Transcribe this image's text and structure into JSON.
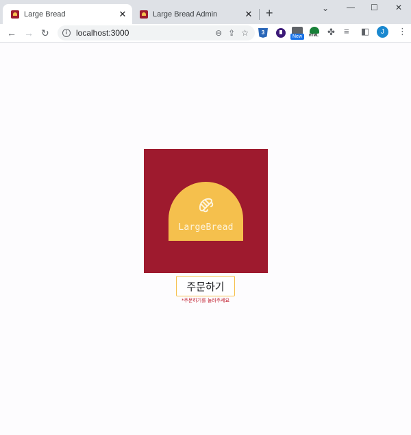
{
  "browser": {
    "tabs": [
      {
        "title": "Large Bread",
        "active": true
      },
      {
        "title": "Large Bread Admin",
        "active": false
      }
    ],
    "new_tab_icon": "plus-icon",
    "address": "localhost:3000",
    "profile_initial": "J",
    "extension_badge": "New",
    "extension_html_label": "HTML",
    "css_ext_label": "3"
  },
  "page": {
    "brand_colors": {
      "primary": "#9e1a2e",
      "accent": "#f5c04d"
    },
    "logo_text": "LargeBread",
    "order_button_label": "주문하기",
    "order_hint": "*주문하기를 눌러주세요"
  }
}
